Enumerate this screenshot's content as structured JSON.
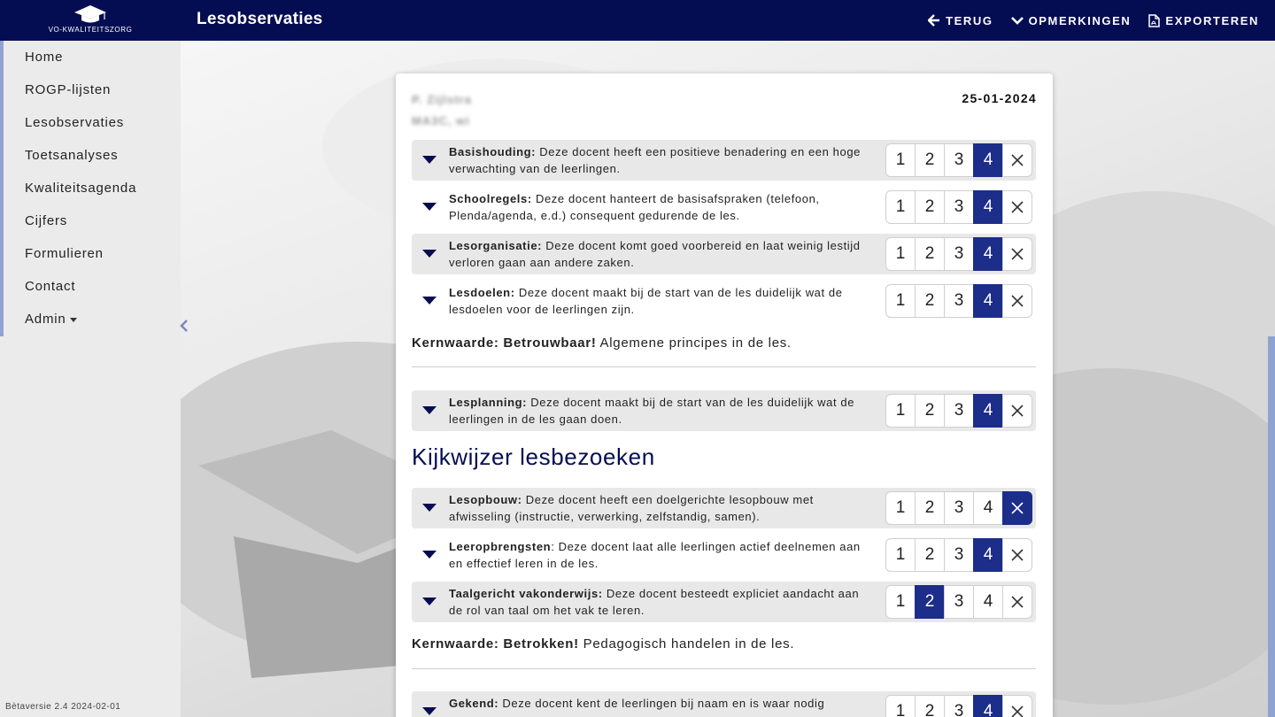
{
  "header": {
    "logo_text": "VO-KWALITEITSZORG",
    "title": "Lesobservaties",
    "actions": [
      {
        "label": "TERUG",
        "icon": "arrow-left-icon"
      },
      {
        "label": "OPMERKINGEN",
        "icon": "chevron-down-icon"
      },
      {
        "label": "EXPORTEREN",
        "icon": "file-pdf-icon"
      }
    ]
  },
  "sidebar": {
    "items": [
      {
        "label": "Home"
      },
      {
        "label": "ROGP-lijsten"
      },
      {
        "label": "Lesobservaties"
      },
      {
        "label": "Toetsanalyses"
      },
      {
        "label": "Kwaliteitsagenda"
      },
      {
        "label": "Cijfers"
      },
      {
        "label": "Formulieren"
      },
      {
        "label": "Contact"
      },
      {
        "label": "Admin"
      }
    ],
    "version": "Bètaversie 2.4 2024-02-01"
  },
  "card": {
    "teacher_name": "P. Zijlstra",
    "class_info": "MA3C, wi",
    "date": "25-01-2024",
    "rating_options": [
      "1",
      "2",
      "3",
      "4"
    ],
    "items_a": [
      {
        "term": "Basishouding:",
        "text": " Deze docent heeft een positieve benadering en een hoge verwachting van de leerlingen.",
        "selected": "4"
      },
      {
        "term": "Schoolregels:",
        "text": " Deze docent hanteert de basisafspraken (telefoon, Plenda/agenda, e.d.) consequent gedurende de les.",
        "selected": "4"
      },
      {
        "term": "Lesorganisatie:",
        "text": " Deze docent komt goed voorbereid en laat weinig lestijd verloren gaan aan andere zaken.",
        "selected": "4"
      },
      {
        "term": "Lesdoelen:",
        "text": " Deze docent maakt bij de start van de les duidelijk wat de lesdoelen voor de leerlingen zijn.",
        "selected": "4"
      }
    ],
    "kernwaarde_1_bold": "Kernwaarde: Betrouwbaar!",
    "kernwaarde_1_text": " Algemene principes in de les.",
    "items_b": [
      {
        "term": "Lesplanning:",
        "text": " Deze docent maakt bij de start van de les duidelijk wat de leerlingen in de les gaan doen.",
        "selected": "4"
      }
    ],
    "section_title": "Kijkwijzer lesbezoeken",
    "items_c": [
      {
        "term": "Lesopbouw:",
        "text": " Deze docent heeft een doelgerichte lesopbouw met afwisseling (instructie, verwerking, zelfstandig, samen).",
        "selected": "x"
      },
      {
        "term": "Leeropbrengsten",
        "text": ": Deze docent laat alle leerlingen actief deelnemen aan en effectief leren in de les.",
        "selected": "4"
      },
      {
        "term": "Taalgericht vakonderwijs:",
        "text": " Deze docent besteedt expliciet aandacht aan de rol van taal om het vak te leren.",
        "selected": "2"
      }
    ],
    "kernwaarde_2_bold": "Kernwaarde: Betrokken!",
    "kernwaarde_2_text": " Pedagogisch handelen in de les.",
    "items_d": [
      {
        "term": "Gekend:",
        "text": " Deze docent kent de leerlingen bij naam en is waar nodig",
        "selected": "4"
      }
    ]
  },
  "colors": {
    "navy": "#050d52",
    "selected": "#1d2d8a",
    "accent": "#8fa3d3"
  }
}
